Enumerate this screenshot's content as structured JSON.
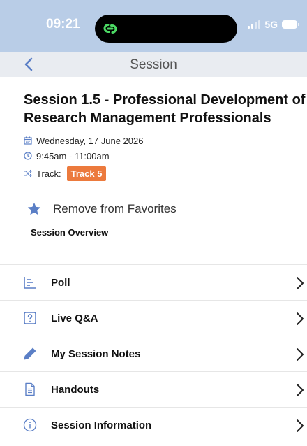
{
  "status_bar": {
    "time": "09:21",
    "network": "5G"
  },
  "nav": {
    "title": "Session"
  },
  "session": {
    "title": "Session 1.5 - Professional Development of Research Management Professionals",
    "date": "Wednesday, 17 June 2026",
    "time": "9:45am - 11:00am",
    "track_label": "Track:",
    "track_value": "Track 5",
    "favorite_label": "Remove from Favorites",
    "overview_label": "Session Overview"
  },
  "menu": {
    "items": [
      {
        "label": "Poll",
        "icon": "poll-icon"
      },
      {
        "label": "Live Q&A",
        "icon": "question-icon"
      },
      {
        "label": "My Session Notes",
        "icon": "pencil-icon"
      },
      {
        "label": "Handouts",
        "icon": "document-icon"
      },
      {
        "label": "Session Information",
        "icon": "info-icon"
      }
    ]
  },
  "colors": {
    "status_bar_bg": "#b9cde7",
    "nav_bar_bg": "#e9ecf1",
    "accent_blue": "#5b7fc6",
    "track_badge": "#ec7a3d",
    "island_icon_green": "#4cd964"
  }
}
